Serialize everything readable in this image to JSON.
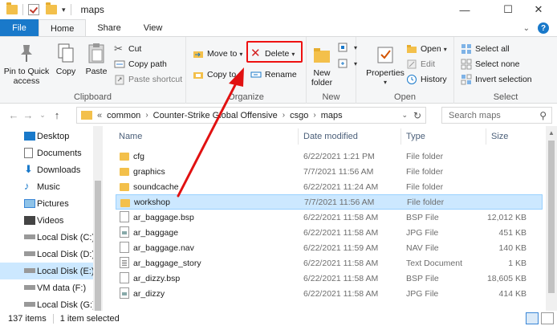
{
  "window": {
    "title": "maps",
    "controls": {
      "minimize": "—",
      "maximize": "☐",
      "close": "✕"
    }
  },
  "tabs": [
    {
      "label": "File"
    },
    {
      "label": "Home"
    },
    {
      "label": "Share"
    },
    {
      "label": "View"
    }
  ],
  "ribbon": {
    "clipboard": {
      "pin_label": "Pin to Quick access",
      "copy_label": "Copy",
      "paste_label": "Paste",
      "cut_label": "Cut",
      "copy_path_label": "Copy path",
      "paste_shortcut_label": "Paste shortcut",
      "group_label": "Clipboard"
    },
    "organize": {
      "move_to_label": "Move to",
      "copy_to_label": "Copy to",
      "delete_label": "Delete",
      "rename_label": "Rename",
      "group_label": "Organize"
    },
    "new": {
      "new_folder_label": "New folder",
      "group_label": "New"
    },
    "open": {
      "properties_label": "Properties",
      "open_label": "Open",
      "edit_label": "Edit",
      "history_label": "History",
      "group_label": "Open"
    },
    "select": {
      "select_all_label": "Select all",
      "select_none_label": "Select none",
      "invert_label": "Invert selection",
      "group_label": "Select"
    }
  },
  "address": {
    "overflow": "«",
    "segments": [
      "common",
      "Counter-Strike Global Offensive",
      "csgo",
      "maps"
    ],
    "search_placeholder": "Search maps"
  },
  "nav_pane": {
    "items": [
      {
        "label": "Desktop",
        "icon": "desktop-icon"
      },
      {
        "label": "Documents",
        "icon": "documents-icon"
      },
      {
        "label": "Downloads",
        "icon": "downloads-icon"
      },
      {
        "label": "Music",
        "icon": "music-icon"
      },
      {
        "label": "Pictures",
        "icon": "pictures-icon"
      },
      {
        "label": "Videos",
        "icon": "videos-icon"
      },
      {
        "label": "Local Disk (C:)",
        "icon": "drive-icon"
      },
      {
        "label": "Local Disk (D:)",
        "icon": "drive-icon"
      },
      {
        "label": "Local Disk  (E:)",
        "icon": "drive-icon"
      },
      {
        "label": "VM data (F:)",
        "icon": "drive-icon"
      },
      {
        "label": "Local Disk (G:)",
        "icon": "drive-icon"
      }
    ]
  },
  "file_list": {
    "columns": {
      "name": "Name",
      "date": "Date modified",
      "type": "Type",
      "size": "Size"
    },
    "rows": [
      {
        "name": "cfg",
        "date": "6/22/2021 1:21 PM",
        "type": "File folder",
        "size": "",
        "kind": "folder"
      },
      {
        "name": "graphics",
        "date": "7/7/2021 11:56 AM",
        "type": "File folder",
        "size": "",
        "kind": "folder"
      },
      {
        "name": "soundcache",
        "date": "6/22/2021 11:24 AM",
        "type": "File folder",
        "size": "",
        "kind": "folder"
      },
      {
        "name": "workshop",
        "date": "7/7/2021 11:56 AM",
        "type": "File folder",
        "size": "",
        "kind": "folder"
      },
      {
        "name": "ar_baggage.bsp",
        "date": "6/22/2021 11:58 AM",
        "type": "BSP File",
        "size": "12,012 KB",
        "kind": "file"
      },
      {
        "name": "ar_baggage",
        "date": "6/22/2021 11:58 AM",
        "type": "JPG File",
        "size": "451 KB",
        "kind": "img"
      },
      {
        "name": "ar_baggage.nav",
        "date": "6/22/2021 11:59 AM",
        "type": "NAV File",
        "size": "140 KB",
        "kind": "file"
      },
      {
        "name": "ar_baggage_story",
        "date": "6/22/2021 11:58 AM",
        "type": "Text Document",
        "size": "1 KB",
        "kind": "doc"
      },
      {
        "name": "ar_dizzy.bsp",
        "date": "6/22/2021 11:58 AM",
        "type": "BSP File",
        "size": "18,605 KB",
        "kind": "file"
      },
      {
        "name": "ar_dizzy",
        "date": "6/22/2021 11:58 AM",
        "type": "JPG File",
        "size": "414 KB",
        "kind": "img"
      }
    ]
  },
  "status": {
    "count": "137 items",
    "selected": "1 item selected"
  },
  "colors": {
    "file_tab": "#1979ca",
    "selection": "#cce8ff",
    "annotation": "#e11111"
  }
}
